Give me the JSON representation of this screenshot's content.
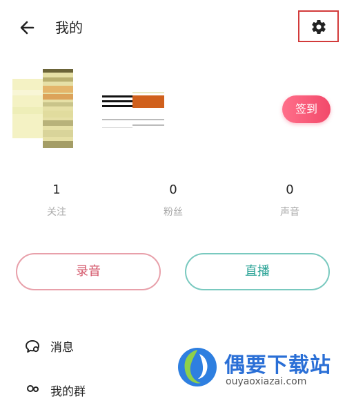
{
  "header": {
    "title": "我的",
    "back_icon": "arrow-left-icon",
    "settings_icon": "gear-icon"
  },
  "profile": {
    "signin_label": "签到"
  },
  "stats": [
    {
      "value": "1",
      "label": "关注"
    },
    {
      "value": "0",
      "label": "粉丝"
    },
    {
      "value": "0",
      "label": "声音"
    }
  ],
  "actions": {
    "record_label": "录音",
    "live_label": "直播"
  },
  "menu": [
    {
      "label": "消息",
      "icon": "message-icon"
    },
    {
      "label": "我的群",
      "icon": "group-icon"
    }
  ],
  "watermark": {
    "text": "偶要下载站",
    "url": "ouyaoxiazai.com"
  },
  "colors": {
    "signin": "#f2496a",
    "record": "#d4576a",
    "live": "#2aa396",
    "highlight": "#d23a3a"
  }
}
